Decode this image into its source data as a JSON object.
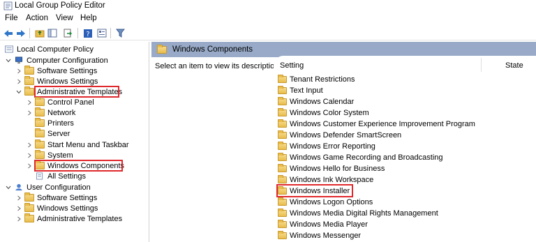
{
  "window": {
    "title": "Local Group Policy Editor",
    "icon": "policy-editor-icon"
  },
  "menu": [
    "File",
    "Action",
    "View",
    "Help"
  ],
  "toolbar": {
    "buttons": [
      "back-arrow-icon",
      "forward-arrow-icon",
      "up-folder-icon",
      "show-hide-tree-icon",
      "export-list-icon",
      "help-icon",
      "properties-icon",
      "filter-icon"
    ]
  },
  "tree": {
    "root": "Local Computer Policy",
    "computer_config": "Computer Configuration",
    "software_settings": "Software Settings",
    "windows_settings": "Windows Settings",
    "admin_templates": "Administrative Templates",
    "control_panel": "Control Panel",
    "network": "Network",
    "printers": "Printers",
    "server": "Server",
    "start_menu": "Start Menu and Taskbar",
    "system": "System",
    "windows_components": "Windows Components",
    "all_settings": "All Settings",
    "user_config": "User Configuration",
    "user_software_settings": "Software Settings",
    "user_windows_settings": "Windows Settings",
    "user_admin_templates": "Administrative Templates"
  },
  "details": {
    "header_title": "Windows Components",
    "description": "Select an item to view its description.",
    "col_setting": "Setting",
    "col_state": "State",
    "items": [
      "Tenant Restrictions",
      "Text Input",
      "Windows Calendar",
      "Windows Color System",
      "Windows Customer Experience Improvement Program",
      "Windows Defender SmartScreen",
      "Windows Error Reporting",
      "Windows Game Recording and Broadcasting",
      "Windows Hello for Business",
      "Windows Ink Workspace",
      "Windows Installer",
      "Windows Logon Options",
      "Windows Media Digital Rights Management",
      "Windows Media Player",
      "Windows Messenger"
    ],
    "highlighted_item": "Windows Installer"
  },
  "colors": {
    "header_bar": "#98aac7",
    "highlight": "#e0282c",
    "folder": "#e9bd4c"
  }
}
